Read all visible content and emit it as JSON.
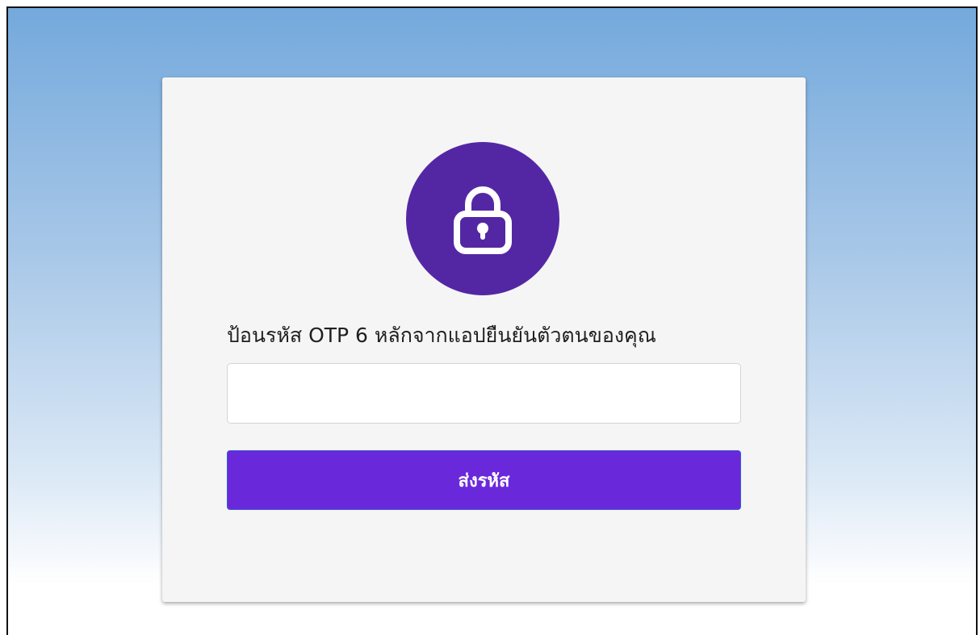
{
  "otp_card": {
    "lock_icon": "lock-icon",
    "prompt": "ป้อนรหัส OTP 6 หลักจากแอปยืนยันตัวตนของคุณ",
    "otp_input": {
      "value": "",
      "placeholder": ""
    },
    "submit_label": "ส่งรหัส"
  },
  "colors": {
    "lock_circle": "#5327a4",
    "button": "#6a28db",
    "card_background": "#f5f5f5",
    "background_top": "#74a9dc",
    "background_bottom": "#ffffff"
  }
}
